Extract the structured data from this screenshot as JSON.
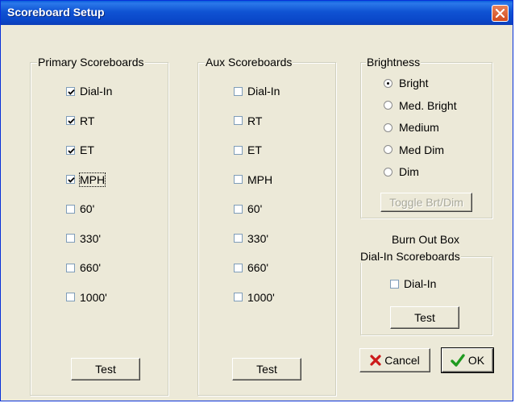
{
  "window": {
    "title": "Scoreboard Setup"
  },
  "primary": {
    "legend": "Primary Scoreboards",
    "items": [
      {
        "label": "Dial-In",
        "checked": true
      },
      {
        "label": "RT",
        "checked": true
      },
      {
        "label": "ET",
        "checked": true
      },
      {
        "label": "MPH",
        "checked": true
      },
      {
        "label": "60'",
        "checked": false
      },
      {
        "label": "330'",
        "checked": false
      },
      {
        "label": "660'",
        "checked": false
      },
      {
        "label": "1000'",
        "checked": false
      }
    ],
    "test_label": "Test"
  },
  "aux": {
    "legend": "Aux Scoreboards",
    "items": [
      {
        "label": "Dial-In",
        "checked": false
      },
      {
        "label": "RT",
        "checked": false
      },
      {
        "label": "ET",
        "checked": false
      },
      {
        "label": "MPH",
        "checked": false
      },
      {
        "label": "60'",
        "checked": false
      },
      {
        "label": "330'",
        "checked": false
      },
      {
        "label": "660'",
        "checked": false
      },
      {
        "label": "1000'",
        "checked": false
      }
    ],
    "test_label": "Test"
  },
  "brightness": {
    "legend": "Brightness",
    "options": [
      {
        "label": "Bright",
        "selected": true
      },
      {
        "label": "Med. Bright",
        "selected": false
      },
      {
        "label": "Medium",
        "selected": false
      },
      {
        "label": "Med Dim",
        "selected": false
      },
      {
        "label": "Dim",
        "selected": false
      }
    ],
    "toggle_label": "Toggle Brt/Dim"
  },
  "burnout": {
    "heading": "Burn Out Box",
    "legend": "Dial-In Scoreboards",
    "item": {
      "label": "Dial-In",
      "checked": false
    },
    "test_label": "Test"
  },
  "actions": {
    "cancel_label": "Cancel",
    "ok_label": "OK"
  },
  "colors": {
    "titlebar": "#0a47c9",
    "dialog_bg": "#ece9d8",
    "cancel_icon": "#cc1a1a",
    "ok_icon": "#1f9a1f"
  },
  "icons": {
    "close": "close-icon",
    "cancel": "x-icon",
    "ok": "checkmark-icon"
  }
}
